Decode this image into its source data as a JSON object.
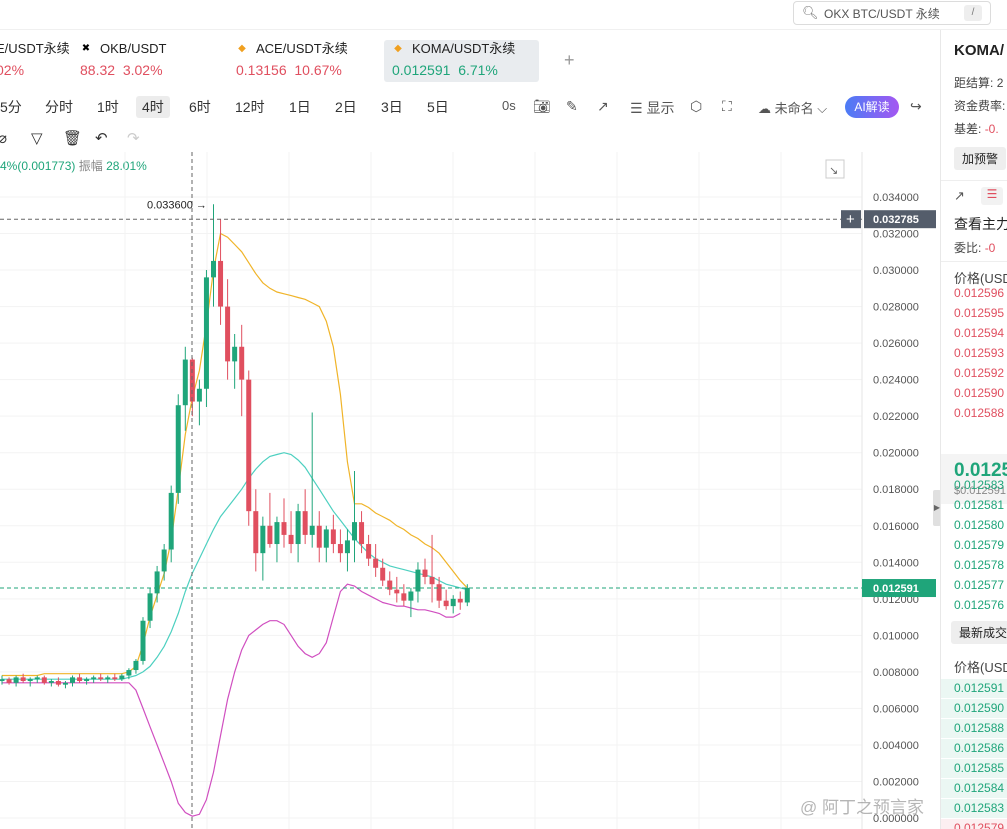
{
  "search": {
    "placeholder": "OKX BTC/USDT 永续",
    "shortcut": "/"
  },
  "tickers": [
    {
      "name": "E/USDT永续",
      "change": "02%",
      "price": "",
      "icon": ""
    },
    {
      "name": "OKB/USDT",
      "price": "88.32",
      "change": "3.02%",
      "icon": "okb-icon"
    },
    {
      "name": "ACE/USDT永续",
      "price": "0.13156",
      "change": "10.67%",
      "icon": "ace-icon"
    },
    {
      "name": "KOMA/USDT永续",
      "price": "0.012591",
      "change": "6.71%",
      "icon": "koma-icon"
    }
  ],
  "add_tab": "+",
  "timeframes": [
    "5分",
    "分时",
    "1时",
    "4时",
    "6时",
    "12时",
    "1日",
    "2日",
    "3日",
    "5日"
  ],
  "selected_timeframe": "4时",
  "toolbar": {
    "countdown": "0s",
    "display_label": "显示",
    "unnamed_label": "未命名",
    "ai_label": "AI解读"
  },
  "indicator": {
    "change": "4%(0.001773)",
    "amp_label": "振幅",
    "amp": "28.01%"
  },
  "chart_data": {
    "type": "candlestick",
    "y_axis_ticks": [
      "0.034000",
      "0.032000",
      "0.030000",
      "0.028000",
      "0.026000",
      "0.024000",
      "0.022000",
      "0.020000",
      "0.018000",
      "0.016000",
      "0.014000",
      "0.012000",
      "0.010000",
      "0.008000",
      "0.006000",
      "0.004000",
      "0.002000",
      "0.000000"
    ],
    "ylim": [
      0.0,
      0.035
    ],
    "high_marker": "0.033600",
    "crosshair_price": "0.032785",
    "last_price": "0.012591",
    "candles": [
      [
        0.0075,
        0.0078,
        0.0073,
        0.0076
      ],
      [
        0.0076,
        0.0077,
        0.0073,
        0.0074
      ],
      [
        0.0074,
        0.0078,
        0.0072,
        0.0077
      ],
      [
        0.0077,
        0.0079,
        0.0074,
        0.0075
      ],
      [
        0.0075,
        0.0077,
        0.0072,
        0.0076
      ],
      [
        0.0076,
        0.0078,
        0.0074,
        0.0077
      ],
      [
        0.0077,
        0.0078,
        0.0073,
        0.0074
      ],
      [
        0.0074,
        0.0076,
        0.0072,
        0.0075
      ],
      [
        0.0075,
        0.0077,
        0.0072,
        0.0073
      ],
      [
        0.0073,
        0.0075,
        0.0071,
        0.0074
      ],
      [
        0.0074,
        0.0078,
        0.0072,
        0.0077
      ],
      [
        0.0077,
        0.0079,
        0.0074,
        0.0075
      ],
      [
        0.0075,
        0.0077,
        0.0073,
        0.0076
      ],
      [
        0.0076,
        0.0078,
        0.0074,
        0.0077
      ],
      [
        0.0077,
        0.0079,
        0.0075,
        0.0076
      ],
      [
        0.0076,
        0.0078,
        0.0074,
        0.0077
      ],
      [
        0.0077,
        0.0079,
        0.0075,
        0.0076
      ],
      [
        0.0076,
        0.0079,
        0.0075,
        0.0078
      ],
      [
        0.0078,
        0.0082,
        0.0076,
        0.0081
      ],
      [
        0.0081,
        0.0087,
        0.0079,
        0.0086
      ],
      [
        0.0086,
        0.011,
        0.0084,
        0.0108
      ],
      [
        0.0108,
        0.0126,
        0.0104,
        0.0123
      ],
      [
        0.0123,
        0.0138,
        0.0118,
        0.0135
      ],
      [
        0.0135,
        0.015,
        0.013,
        0.0147
      ],
      [
        0.0147,
        0.0182,
        0.014,
        0.0178
      ],
      [
        0.0178,
        0.0232,
        0.0172,
        0.0226
      ],
      [
        0.0226,
        0.0258,
        0.0212,
        0.0251
      ],
      [
        0.0251,
        0.0252,
        0.022,
        0.0228
      ],
      [
        0.0228,
        0.024,
        0.0215,
        0.0235
      ],
      [
        0.0235,
        0.03,
        0.0225,
        0.0296
      ],
      [
        0.0296,
        0.0336,
        0.028,
        0.0305
      ],
      [
        0.0305,
        0.0328,
        0.027,
        0.028
      ],
      [
        0.028,
        0.0295,
        0.024,
        0.025
      ],
      [
        0.025,
        0.0265,
        0.0235,
        0.0258
      ],
      [
        0.0258,
        0.027,
        0.022,
        0.024
      ],
      [
        0.024,
        0.0245,
        0.016,
        0.0168
      ],
      [
        0.0168,
        0.018,
        0.0135,
        0.0145
      ],
      [
        0.0145,
        0.0165,
        0.013,
        0.016
      ],
      [
        0.016,
        0.0178,
        0.0148,
        0.015
      ],
      [
        0.015,
        0.0165,
        0.014,
        0.0162
      ],
      [
        0.0162,
        0.0175,
        0.0148,
        0.0155
      ],
      [
        0.0155,
        0.0168,
        0.0145,
        0.015
      ],
      [
        0.015,
        0.0172,
        0.014,
        0.0168
      ],
      [
        0.0168,
        0.018,
        0.015,
        0.0155
      ],
      [
        0.0155,
        0.0222,
        0.0148,
        0.016
      ],
      [
        0.016,
        0.0168,
        0.014,
        0.0148
      ],
      [
        0.0148,
        0.016,
        0.014,
        0.0158
      ],
      [
        0.0158,
        0.0166,
        0.0145,
        0.015
      ],
      [
        0.015,
        0.0158,
        0.014,
        0.0145
      ],
      [
        0.0145,
        0.0158,
        0.0135,
        0.0152
      ],
      [
        0.0152,
        0.019,
        0.014,
        0.0162
      ],
      [
        0.0162,
        0.0168,
        0.0145,
        0.015
      ],
      [
        0.015,
        0.0155,
        0.0138,
        0.0142
      ],
      [
        0.0142,
        0.015,
        0.0132,
        0.0137
      ],
      [
        0.0137,
        0.0142,
        0.0127,
        0.013
      ],
      [
        0.013,
        0.0135,
        0.0122,
        0.0125
      ],
      [
        0.0125,
        0.0132,
        0.0118,
        0.0123
      ],
      [
        0.0123,
        0.0128,
        0.0116,
        0.0119
      ],
      [
        0.0119,
        0.0126,
        0.011,
        0.0124
      ],
      [
        0.0124,
        0.014,
        0.0118,
        0.0136
      ],
      [
        0.0136,
        0.0142,
        0.0128,
        0.0132
      ],
      [
        0.0132,
        0.0155,
        0.0118,
        0.0128
      ],
      [
        0.0128,
        0.0132,
        0.0115,
        0.0119
      ],
      [
        0.0119,
        0.0125,
        0.0114,
        0.0116
      ],
      [
        0.0116,
        0.0122,
        0.0112,
        0.012
      ],
      [
        0.012,
        0.0124,
        0.0114,
        0.0118
      ],
      [
        0.0118,
        0.0128,
        0.0116,
        0.0126
      ]
    ],
    "ma_orange": [
      0.0078,
      0.0078,
      0.0078,
      0.0078,
      0.0078,
      0.0078,
      0.0079,
      0.0079,
      0.0079,
      0.0079,
      0.0079,
      0.0079,
      0.0079,
      0.0079,
      0.0079,
      0.0079,
      0.0079,
      0.0079,
      0.008,
      0.0083,
      0.0095,
      0.011,
      0.0122,
      0.0134,
      0.0152,
      0.018,
      0.021,
      0.023,
      0.0245,
      0.027,
      0.03,
      0.032,
      0.0318,
      0.0314,
      0.031,
      0.0304,
      0.0298,
      0.0293,
      0.029,
      0.0288,
      0.0287,
      0.0286,
      0.0285,
      0.0284,
      0.0282,
      0.028,
      0.0272,
      0.0258,
      0.0232,
      0.0195,
      0.0172,
      0.0172,
      0.017,
      0.0167,
      0.0165,
      0.0163,
      0.016,
      0.0158,
      0.0155,
      0.0153,
      0.015,
      0.0148,
      0.0145,
      0.014,
      0.0135,
      0.013,
      0.0126
    ],
    "ma_teal": [
      0.0076,
      0.0076,
      0.0076,
      0.0076,
      0.0076,
      0.0076,
      0.0076,
      0.0076,
      0.0076,
      0.0076,
      0.0076,
      0.0076,
      0.0076,
      0.0076,
      0.0076,
      0.0076,
      0.0076,
      0.0076,
      0.0077,
      0.0078,
      0.008,
      0.0083,
      0.0088,
      0.0094,
      0.0102,
      0.0112,
      0.0124,
      0.0134,
      0.0142,
      0.015,
      0.0158,
      0.0165,
      0.017,
      0.0175,
      0.018,
      0.0186,
      0.0191,
      0.0195,
      0.0198,
      0.0199,
      0.02,
      0.0199,
      0.0196,
      0.0192,
      0.0186,
      0.018,
      0.0174,
      0.0168,
      0.0163,
      0.0158,
      0.0153,
      0.0149,
      0.0145,
      0.0142,
      0.014,
      0.0138,
      0.0137,
      0.0136,
      0.0135,
      0.0134,
      0.0133,
      0.0132,
      0.013,
      0.0128,
      0.0127,
      0.0126,
      0.0125
    ],
    "ma_magenta": [
      0.0074,
      0.0074,
      0.0074,
      0.0074,
      0.0074,
      0.0074,
      0.0074,
      0.0074,
      0.0074,
      0.0074,
      0.0074,
      0.0074,
      0.0074,
      0.0074,
      0.0074,
      0.0074,
      0.0074,
      0.0074,
      0.0074,
      0.007,
      0.006,
      0.005,
      0.004,
      0.003,
      0.002,
      0.0008,
      0.0003,
      0.0001,
      0.0002,
      0.001,
      0.0025,
      0.0045,
      0.0065,
      0.008,
      0.0092,
      0.01,
      0.0103,
      0.0106,
      0.0108,
      0.0108,
      0.0106,
      0.01,
      0.0094,
      0.009,
      0.0088,
      0.009,
      0.0096,
      0.011,
      0.0124,
      0.0128,
      0.0127,
      0.0124,
      0.0122,
      0.012,
      0.0118,
      0.0117,
      0.0116,
      0.0116,
      0.0115,
      0.0114,
      0.0114,
      0.0113,
      0.0112,
      0.011,
      0.011,
      0.0112
    ]
  },
  "right_panel": {
    "title": "KOMA/",
    "settle_label": "距结算:",
    "settle_val": "2",
    "funding_label": "资金费率:",
    "basis_label": "基差:",
    "basis_val": "-0.",
    "alert_btn": "加预警",
    "main_force": "查看主力",
    "ratio_label": "委比:",
    "ratio_val": "-0",
    "price_header": "价格(USD",
    "asks": [
      "0.012596",
      "0.012595",
      "0.012594",
      "0.012593",
      "0.012592",
      "0.012590",
      "0.012588"
    ],
    "mid_price": "0.0125",
    "mid_sub": "$0.012591",
    "bids": [
      "0.012583",
      "0.012581",
      "0.012580",
      "0.012579",
      "0.012578",
      "0.012577",
      "0.012576"
    ],
    "latest_trades_label": "最新成交",
    "price_header2": "价格(USD",
    "trades": [
      "0.012591",
      "0.012590",
      "0.012588",
      "0.012586",
      "0.012585",
      "0.012584",
      "0.012583",
      "0.012579"
    ]
  },
  "watermark": "@ 阿丁之预言家",
  "colors": {
    "up": "#1fa57a",
    "down": "#e04f5f",
    "ma_orange": "#f0b429",
    "ma_teal": "#4dd0c0",
    "ma_magenta": "#d04fc0"
  }
}
